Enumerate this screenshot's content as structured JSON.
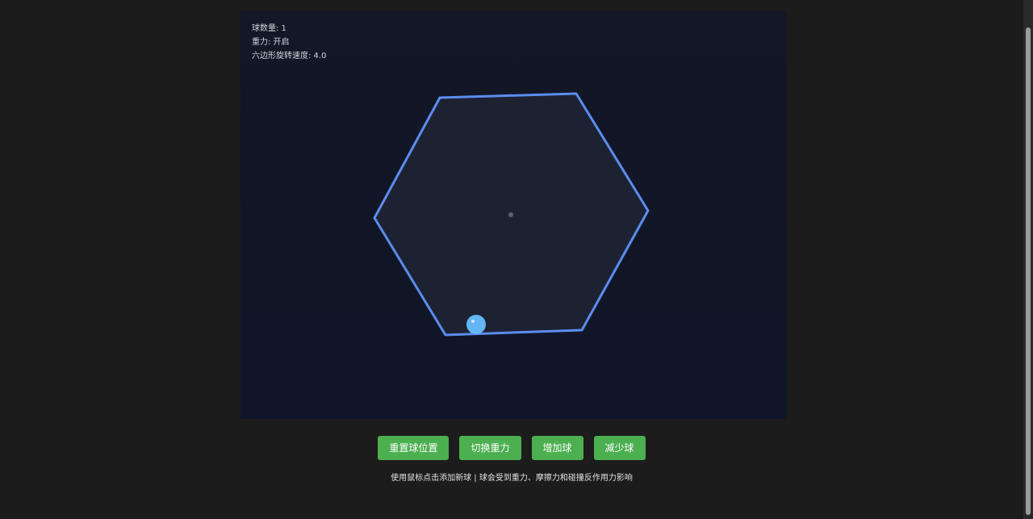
{
  "stats": {
    "ball_count": "球数量: 1",
    "gravity": "重力: 开启",
    "rotation_speed": "六边形旋转速度: 4.0"
  },
  "buttons": {
    "reset": "重置球位置",
    "toggle_gravity": "切换重力",
    "add_ball": "增加球",
    "remove_ball": "减少球"
  },
  "hint": "使用鼠标点击添加新球 | 球会受到重力、摩擦力和碰撞反作用力影响",
  "colors": {
    "hexagon_stroke": "#5b8def",
    "ball": "#64b5f6",
    "button": "#4caf50",
    "canvas_bg": "#131726"
  }
}
